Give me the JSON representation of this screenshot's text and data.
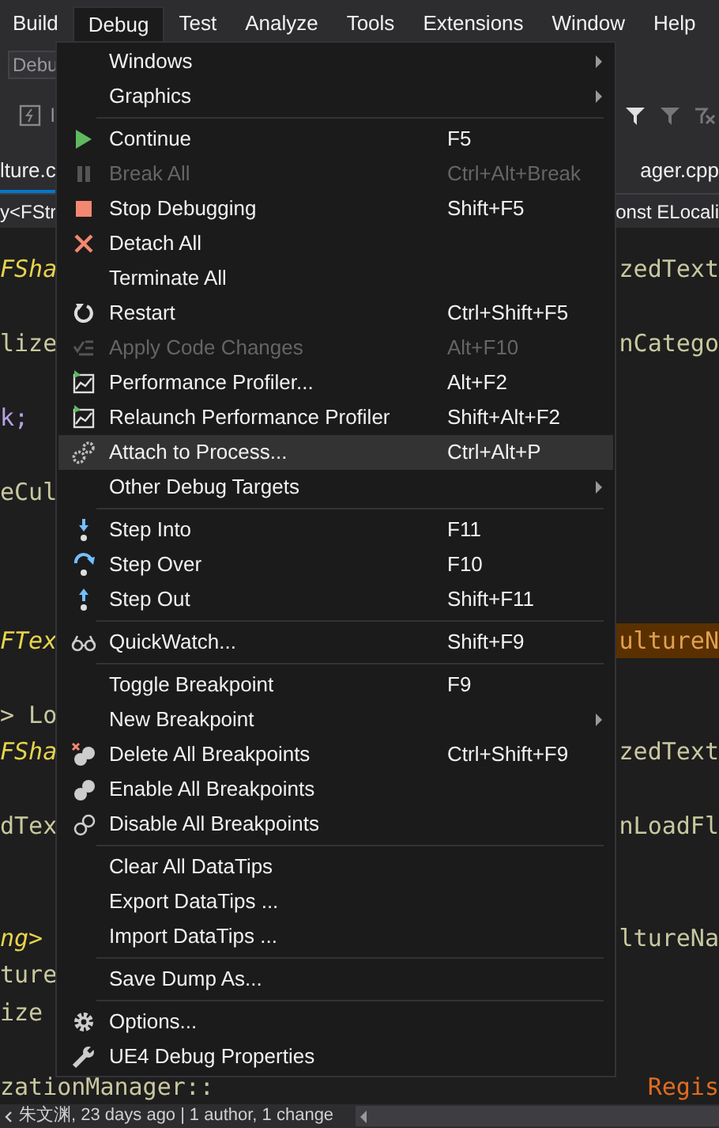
{
  "menu_bar": [
    {
      "label": "Build",
      "selected": false
    },
    {
      "label": "Debug",
      "selected": true
    },
    {
      "label": "Test",
      "selected": false
    },
    {
      "label": "Analyze",
      "selected": false
    },
    {
      "label": "Tools",
      "selected": false
    },
    {
      "label": "Extensions",
      "selected": false
    },
    {
      "label": "Window",
      "selected": false
    },
    {
      "label": "Help",
      "selected": false
    }
  ],
  "toolbar": {
    "config_combo": "Debu",
    "toolbar_label": "l"
  },
  "tabs": [
    {
      "label": "lture.c",
      "selected": true
    },
    {
      "label": "ager.cpp",
      "selected": false
    }
  ],
  "nav_bar": {
    "left": "y<FStr",
    "right": "onst ELocali"
  },
  "code_lines": [
    {
      "kind": "text",
      "left": {
        "text": "FSha",
        "color": "#e8d44d",
        "italic": true
      },
      "right": {
        "text": "zedText",
        "color": "#c8c8a0",
        "italic": false,
        "highlighted": false
      }
    },
    {
      "kind": "blank"
    },
    {
      "kind": "text",
      "left": {
        "text": "lize",
        "color": "#c8c8a0",
        "italic": false
      },
      "right": {
        "text": "nCatego",
        "color": "#c8c8a0",
        "italic": false,
        "highlighted": false
      }
    },
    {
      "kind": "blank"
    },
    {
      "kind": "text",
      "left": {
        "text": "k;",
        "color": "#b8a0e8",
        "italic": false
      }
    },
    {
      "kind": "blank"
    },
    {
      "kind": "text",
      "left": {
        "text": "eCul",
        "color": "#c8c8a0",
        "italic": false
      }
    },
    {
      "kind": "blank"
    },
    {
      "kind": "blank"
    },
    {
      "kind": "blank"
    },
    {
      "kind": "text",
      "left": {
        "text": "FTex",
        "color": "#e8d44d",
        "italic": true
      },
      "right": {
        "text": "ultureN",
        "color": "#e0a050",
        "italic": false,
        "highlighted": true
      }
    },
    {
      "kind": "blank"
    },
    {
      "kind": "text",
      "left": {
        "text": "> Lo",
        "color": "#c8c8a0",
        "italic": false
      }
    },
    {
      "kind": "text",
      "left": {
        "text": "FSha",
        "color": "#e8d44d",
        "italic": true
      },
      "right": {
        "text": "zedText",
        "color": "#c8c8a0",
        "italic": false,
        "highlighted": false
      }
    },
    {
      "kind": "blank"
    },
    {
      "kind": "text",
      "left": {
        "text": "dTex",
        "color": "#c8c8a0",
        "italic": false
      },
      "right": {
        "text": "nLoadFl",
        "color": "#c8c8a0",
        "italic": false,
        "highlighted": false
      }
    },
    {
      "kind": "blank"
    },
    {
      "kind": "blank"
    },
    {
      "kind": "text",
      "left": {
        "text": "ng>",
        "color": "#e8d44d",
        "italic": true
      },
      "right": {
        "text": "ltureNa",
        "color": "#c8c8a0",
        "italic": false,
        "highlighted": false
      }
    },
    {
      "kind": "text",
      "left": {
        "text": "ture",
        "color": "#c8c8a0",
        "italic": false
      }
    },
    {
      "kind": "text",
      "left": {
        "text": "ize",
        "color": "#c8c8a0",
        "italic": false
      }
    },
    {
      "kind": "blank"
    },
    {
      "kind": "text",
      "left": {
        "text": "zationManager::",
        "color": "#c8c8a0",
        "italic": false
      },
      "right": {
        "text": "Regis",
        "color": "#e06c20",
        "italic": false,
        "highlighted": false
      }
    }
  ],
  "menu": [
    {
      "kind": "item",
      "label": "Windows",
      "submenu": true,
      "disabled": false,
      "selected": false
    },
    {
      "kind": "item",
      "label": "Graphics",
      "submenu": true,
      "disabled": false,
      "selected": false
    },
    {
      "kind": "separator"
    },
    {
      "kind": "item",
      "label": "Continue",
      "shortcut": "F5",
      "disabled": false,
      "selected": false
    },
    {
      "kind": "item",
      "label": "Break All",
      "shortcut": "Ctrl+Alt+Break",
      "disabled": true,
      "selected": false
    },
    {
      "kind": "item",
      "label": "Stop Debugging",
      "shortcut": "Shift+F5",
      "disabled": false,
      "selected": false
    },
    {
      "kind": "item",
      "label": "Detach All",
      "disabled": false,
      "selected": false
    },
    {
      "kind": "item",
      "label": "Terminate All",
      "disabled": false,
      "selected": false
    },
    {
      "kind": "item",
      "label": "Restart",
      "shortcut": "Ctrl+Shift+F5",
      "disabled": false,
      "selected": false
    },
    {
      "kind": "item",
      "label": "Apply Code Changes",
      "shortcut": "Alt+F10",
      "disabled": true,
      "selected": false
    },
    {
      "kind": "item",
      "label": "Performance Profiler...",
      "shortcut": "Alt+F2",
      "disabled": false,
      "selected": false
    },
    {
      "kind": "item",
      "label": "Relaunch Performance Profiler",
      "shortcut": "Shift+Alt+F2",
      "disabled": false,
      "selected": false
    },
    {
      "kind": "item",
      "label": "Attach to Process...",
      "shortcut": "Ctrl+Alt+P",
      "disabled": false,
      "selected": true
    },
    {
      "kind": "item",
      "label": "Other Debug Targets",
      "submenu": true,
      "disabled": false,
      "selected": false
    },
    {
      "kind": "separator"
    },
    {
      "kind": "item",
      "label": "Step Into",
      "shortcut": "F11",
      "disabled": false,
      "selected": false
    },
    {
      "kind": "item",
      "label": "Step Over",
      "shortcut": "F10",
      "disabled": false,
      "selected": false
    },
    {
      "kind": "item",
      "label": "Step Out",
      "shortcut": "Shift+F11",
      "disabled": false,
      "selected": false
    },
    {
      "kind": "separator"
    },
    {
      "kind": "item",
      "label": "QuickWatch...",
      "shortcut": "Shift+F9",
      "disabled": false,
      "selected": false
    },
    {
      "kind": "separator"
    },
    {
      "kind": "item",
      "label": "Toggle Breakpoint",
      "shortcut": "F9",
      "disabled": false,
      "selected": false
    },
    {
      "kind": "item",
      "label": "New Breakpoint",
      "submenu": true,
      "disabled": false,
      "selected": false
    },
    {
      "kind": "item",
      "label": "Delete All Breakpoints",
      "shortcut": "Ctrl+Shift+F9",
      "disabled": false,
      "selected": false
    },
    {
      "kind": "item",
      "label": "Enable All Breakpoints",
      "disabled": false,
      "selected": false
    },
    {
      "kind": "item",
      "label": "Disable All Breakpoints",
      "disabled": false,
      "selected": false
    },
    {
      "kind": "separator"
    },
    {
      "kind": "item",
      "label": "Clear All DataTips",
      "disabled": false,
      "selected": false
    },
    {
      "kind": "item",
      "label": "Export DataTips ...",
      "disabled": false,
      "selected": false
    },
    {
      "kind": "item",
      "label": "Import DataTips ...",
      "disabled": false,
      "selected": false
    },
    {
      "kind": "separator"
    },
    {
      "kind": "item",
      "label": "Save Dump As...",
      "disabled": false,
      "selected": false
    },
    {
      "kind": "separator"
    },
    {
      "kind": "item",
      "label": "Options...",
      "disabled": false,
      "selected": false
    },
    {
      "kind": "item",
      "label": "UE4 Debug Properties",
      "disabled": false,
      "selected": false
    }
  ],
  "status_bar": {
    "author_time": "朱文渊, 23 days ago",
    "divider": "|",
    "changes": "1 author, 1 change"
  }
}
